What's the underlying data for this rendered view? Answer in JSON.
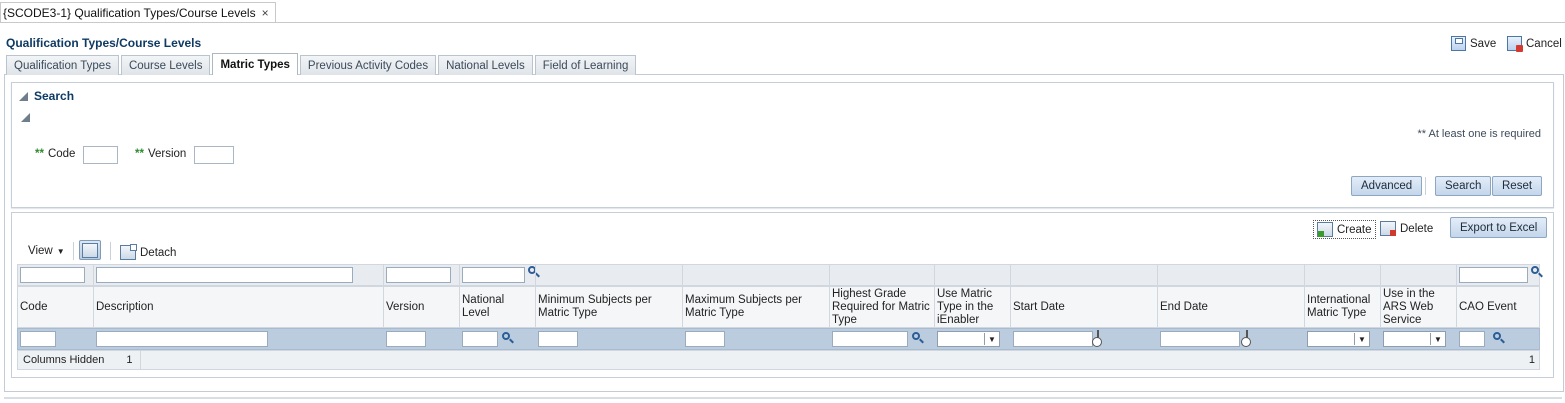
{
  "window": {
    "tab_title": "{SCODE3-1} Qualification Types/Course Levels",
    "close_glyph": "×"
  },
  "page": {
    "title": "Qualification Types/Course Levels"
  },
  "actions": {
    "save": "Save",
    "cancel": "Cancel"
  },
  "tabs": [
    {
      "label": "Qualification Types",
      "active": false
    },
    {
      "label": "Course Levels",
      "active": false
    },
    {
      "label": "Matric Types",
      "active": true
    },
    {
      "label": "Previous Activity Codes",
      "active": false
    },
    {
      "label": "National Levels",
      "active": false
    },
    {
      "label": "Field of Learning",
      "active": false
    }
  ],
  "search": {
    "title": "Search",
    "required_marker": "**",
    "hint": "** At least one is required",
    "fields": {
      "code_label": "Code",
      "code_value": "",
      "version_label": "Version",
      "version_value": ""
    },
    "buttons": {
      "advanced": "Advanced",
      "search": "Search",
      "reset": "Reset"
    }
  },
  "table_toolbar": {
    "create": "Create",
    "delete": "Delete",
    "export": "Export to Excel",
    "view": "View",
    "detach": "Detach"
  },
  "columns": [
    "Code",
    "Description",
    "Version",
    "National Level",
    "Minimum Subjects per Matric Type",
    "Maximum Subjects per Matric Type",
    "Highest Grade Required for Matric Type",
    "Use Matric Type in the iEnabler",
    "Start Date",
    "End Date",
    "International Matric Type",
    "Use in the ARS Web Service",
    "CAO Event"
  ],
  "footer": {
    "columns_hidden_label": "Columns Hidden",
    "columns_hidden_count": "1",
    "page_count": "1"
  },
  "colors": {
    "accent": "#0e3a63",
    "selected_row": "#bcccdf",
    "required": "#2f8a2f"
  }
}
